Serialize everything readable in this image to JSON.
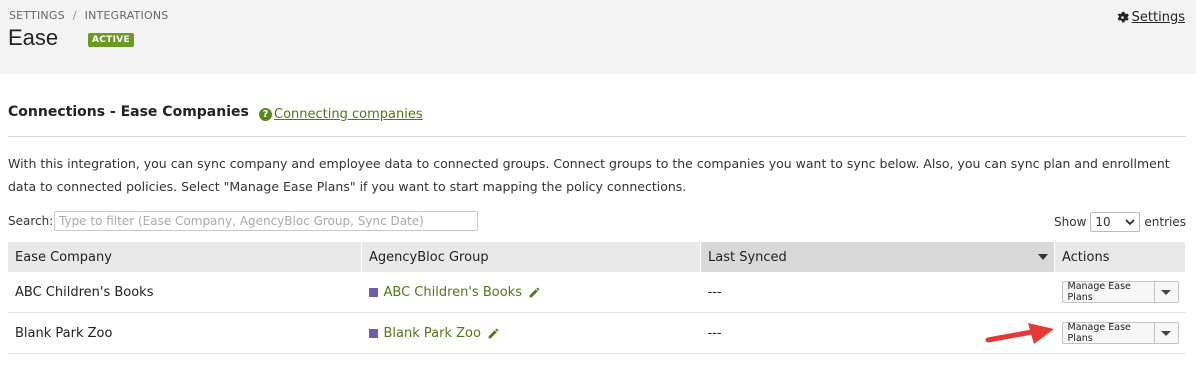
{
  "breadcrumb": {
    "parent": "SETTINGS",
    "separator": "/",
    "current": "INTEGRATIONS"
  },
  "page": {
    "title": "Ease",
    "status": "ACTIVE"
  },
  "header": {
    "settings_label": "Settings",
    "settings_icon": "gear-icon"
  },
  "section": {
    "title": "Connections - Ease Companies",
    "help_link": "Connecting companies",
    "description": "With this integration, you can sync company and employee data to connected groups. Connect groups to the companies you want to sync below. Also, you can sync plan and enrollment data to connected policies. Select \"Manage Ease Plans\" if you want to start mapping the policy connections."
  },
  "search": {
    "label": "Search:",
    "placeholder": "Type to filter (Ease Company, AgencyBloc Group, Sync Date)",
    "value": ""
  },
  "paging": {
    "show_label": "Show",
    "entries_value": "10",
    "entries_label": "entries"
  },
  "table": {
    "columns": [
      "Ease Company",
      "AgencyBloc Group",
      "Last Synced",
      "Actions"
    ],
    "rows": [
      {
        "company": "ABC Children's Books",
        "group": "ABC Children's Books",
        "last_synced": "---",
        "action": "Manage Ease Plans"
      },
      {
        "company": "Blank Park Zoo",
        "group": "Blank Park Zoo",
        "last_synced": "---",
        "action": "Manage Ease Plans"
      }
    ]
  },
  "colors": {
    "accent": "#4d7a16",
    "badge": "#6a9a1f",
    "swatch": "#6b5fb0",
    "annotation_arrow": "#e53935"
  }
}
